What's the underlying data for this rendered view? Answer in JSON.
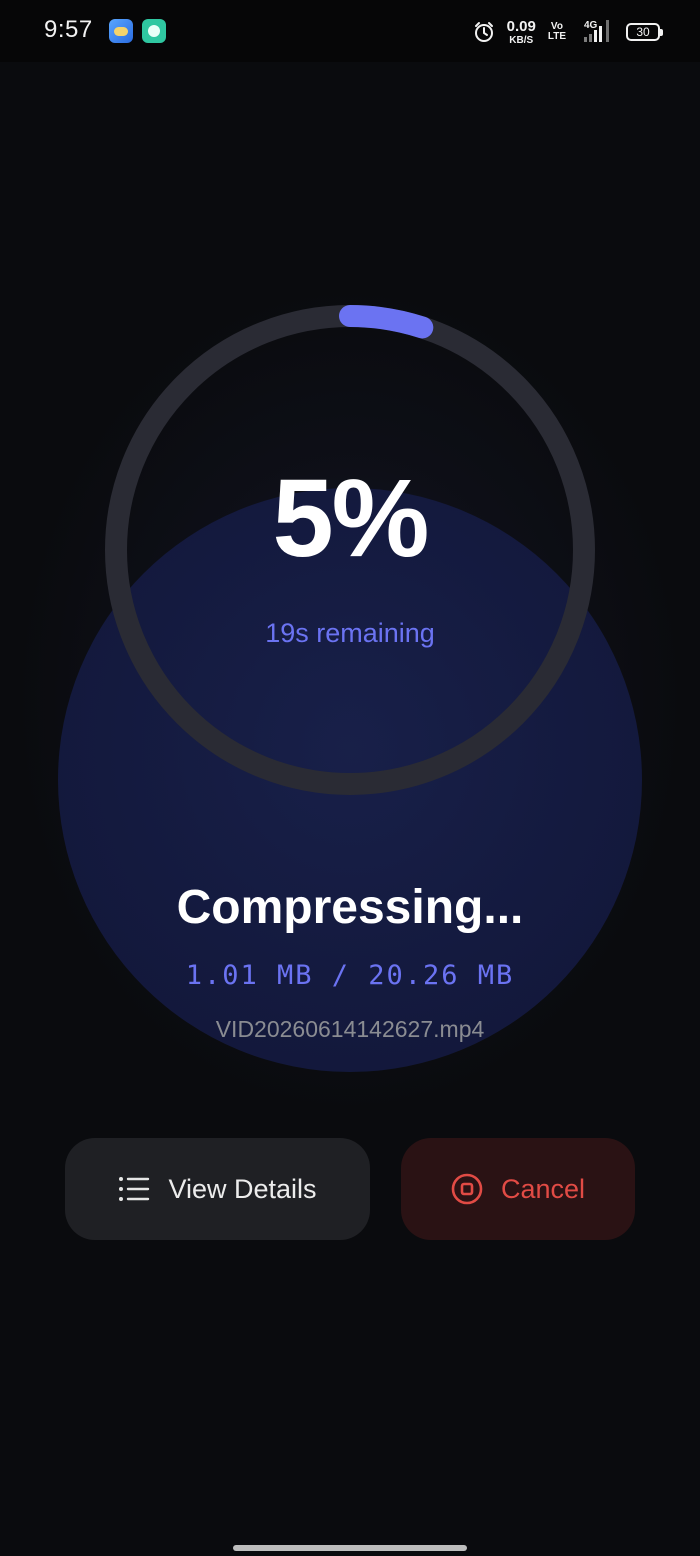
{
  "status_bar": {
    "time": "9:57",
    "net_speed_value": "0.09",
    "net_speed_unit": "KB/S",
    "volte_top": "Vo",
    "volte_bottom": "LTE",
    "network_type": "4G",
    "battery": "30",
    "icons": [
      "weather-app-icon",
      "chat-app-icon",
      "alarm-icon",
      "signal-icon",
      "battery-icon"
    ]
  },
  "progress": {
    "percent": 5,
    "percent_label": "5%",
    "remaining": "19s remaining",
    "accent_color": "#6b73f2",
    "track_color": "#2a2b34"
  },
  "compression": {
    "title": "Compressing...",
    "size_progress": "1.01 MB / 20.26 MB",
    "file_name": "VID20260614142627.mp4"
  },
  "actions": {
    "details_label": "View Details",
    "details_icon": "list-icon",
    "cancel_label": "Cancel",
    "cancel_icon": "stop-circle-icon",
    "cancel_color": "#e14b45"
  }
}
